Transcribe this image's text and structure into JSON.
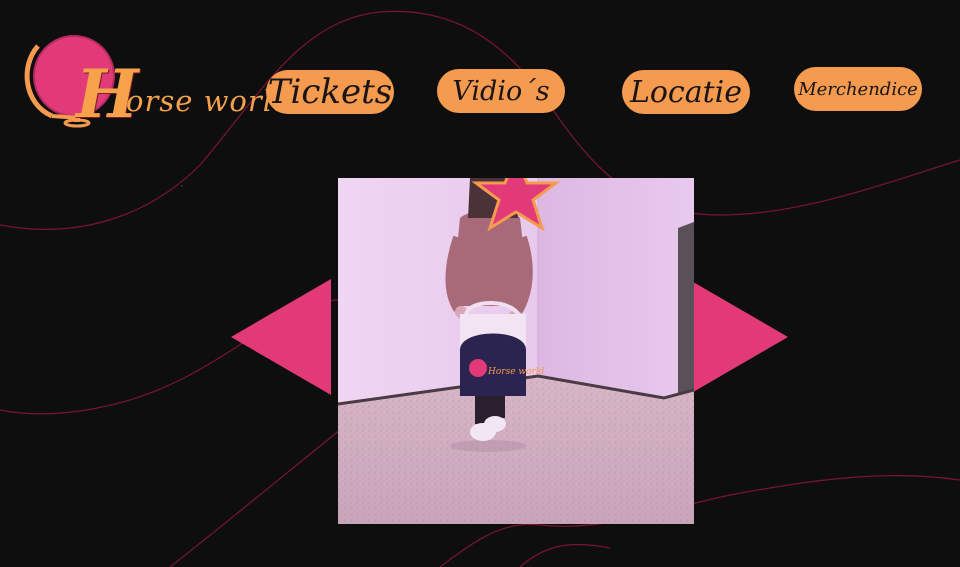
{
  "brand": {
    "logo_initial": "H",
    "logo_text": "orse world"
  },
  "nav": [
    {
      "label": "Tickets"
    },
    {
      "label": "Vidio´s"
    },
    {
      "label": "Locatie"
    },
    {
      "label": "Merchendice"
    }
  ],
  "carousel": {
    "prev_icon": "triangle-left-icon",
    "next_icon": "triangle-right-icon",
    "bag_print": "Horse world"
  },
  "colors": {
    "background": "#0f0e0f",
    "accent_orange": "#f49b4f",
    "accent_pink": "#e23a79",
    "line_red": "#7a1530"
  }
}
